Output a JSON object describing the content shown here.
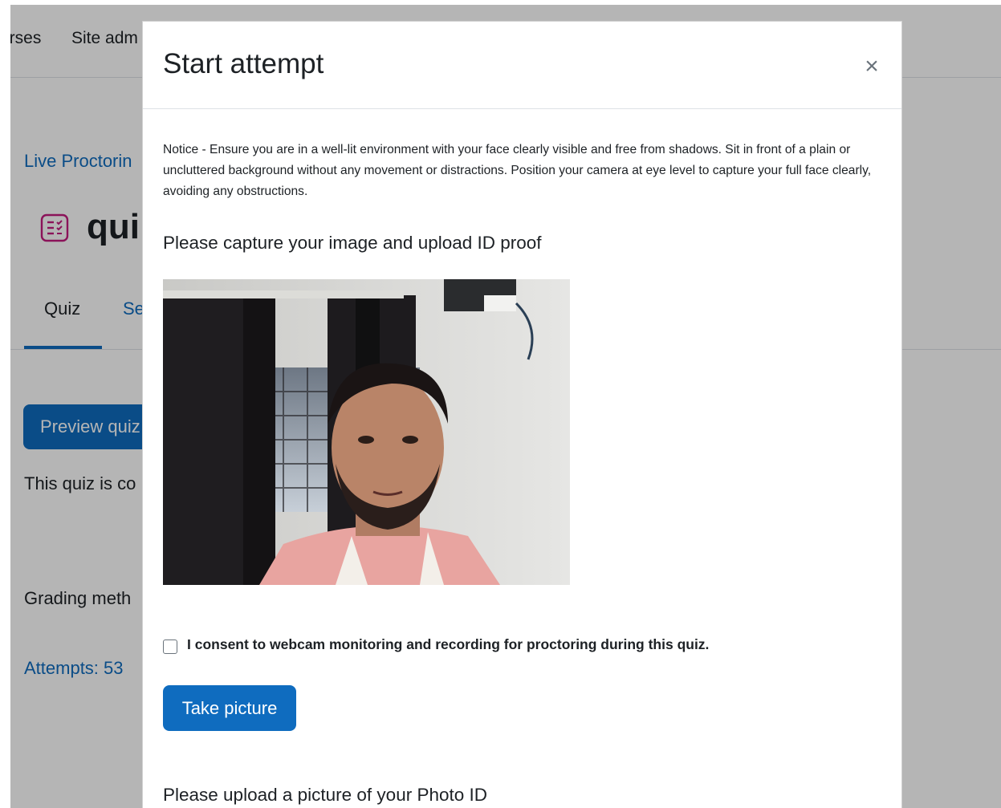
{
  "background": {
    "nav": {
      "courses_partial": "urses",
      "site_admin_partial": "Site adm"
    },
    "breadcrumb": "Live Proctorin",
    "page_title_partial": "qui",
    "tabs": {
      "quiz": "Quiz",
      "settings_partial": "Se"
    },
    "preview_button": "Preview quiz",
    "closed_text_partial": "This quiz is co",
    "grading_partial": "Grading meth",
    "attempts": "Attempts: 53",
    "icons": {
      "quiz": "quiz-icon"
    }
  },
  "modal": {
    "title": "Start attempt",
    "close_symbol": "×",
    "notice": "Notice - Ensure you are in a well-lit environment with your face clearly visible and free from shadows. Sit in front of a plain or uncluttered background without any movement or distractions. Position your camera at eye level to capture your full face clearly, avoiding any obstructions.",
    "capture_heading": "Please capture your image and upload ID proof",
    "consent": {
      "label": "I consent to webcam monitoring and recording for proctoring during this quiz.",
      "checked": false
    },
    "take_picture_button": "Take picture",
    "upload_heading": "Please upload a picture of your Photo ID"
  },
  "colors": {
    "primary": "#0f6cbf",
    "quiz_icon": "#c41b7e",
    "backdrop": "rgba(0,0,0,0.29)"
  }
}
